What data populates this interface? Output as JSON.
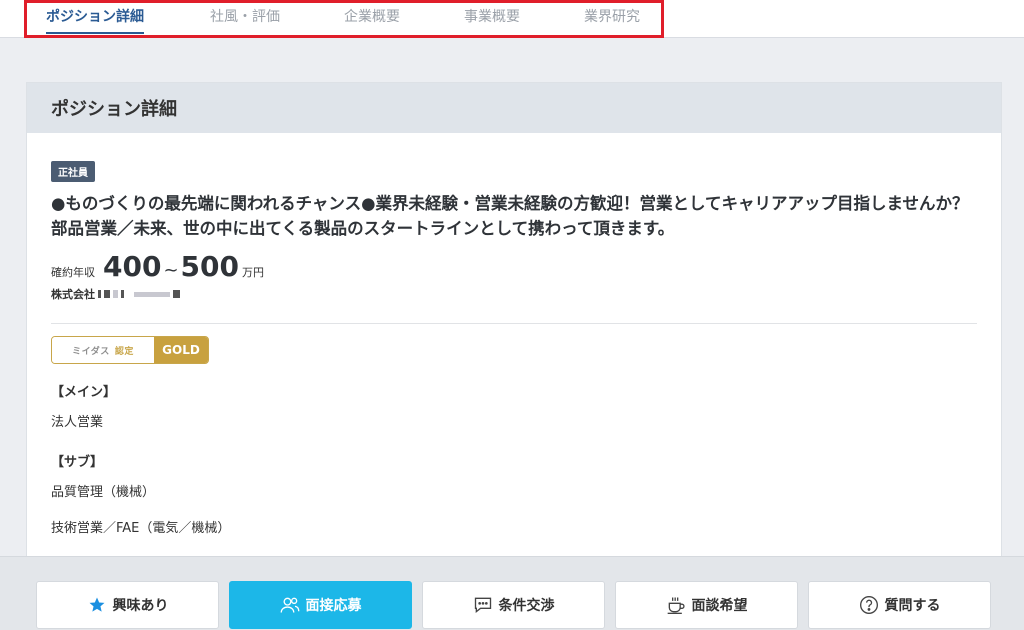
{
  "tabs": [
    {
      "label": "ポジション詳細",
      "active": true
    },
    {
      "label": "社風・評価",
      "active": false
    },
    {
      "label": "企業概要",
      "active": false
    },
    {
      "label": "事業概要",
      "active": false
    },
    {
      "label": "業界研究",
      "active": false
    }
  ],
  "card": {
    "title": "ポジション詳細",
    "employment_badge": "正社員",
    "job_title": "●ものづくりの最先端に関われるチャンス●業界未経験・営業未経験の方歓迎！営業としてキャリアアップ目指しませんか？部品営業／未来、世の中に出てくる製品のスタートラインとして携わって頂きます。",
    "salary": {
      "label": "確約年収",
      "min": "400",
      "separator": "~",
      "max": "500",
      "unit": "万円"
    },
    "company_prefix": "株式会社",
    "cert": {
      "brand": "ミイダス",
      "label": "認定",
      "level": "GOLD"
    },
    "main_head": "【メイン】",
    "main_items": [
      "法人営業"
    ],
    "sub_head": "【サブ】",
    "sub_items": [
      "品質管理（機械）",
      "技術営業／FAE（電気／機械）"
    ]
  },
  "actions": [
    {
      "label": "興味あり",
      "icon": "star-icon"
    },
    {
      "label": "面接応募",
      "icon": "users-icon"
    },
    {
      "label": "条件交渉",
      "icon": "chat-icon"
    },
    {
      "label": "面談希望",
      "icon": "coffee-cup-icon"
    },
    {
      "label": "質問する",
      "icon": "question-circle-icon"
    }
  ],
  "colors": {
    "accent": "#1cb7e8",
    "active_tab": "#2a5a93",
    "highlight_border": "#e01e2a",
    "gold": "#c8a13f",
    "badge_bg": "#4b5c72"
  }
}
